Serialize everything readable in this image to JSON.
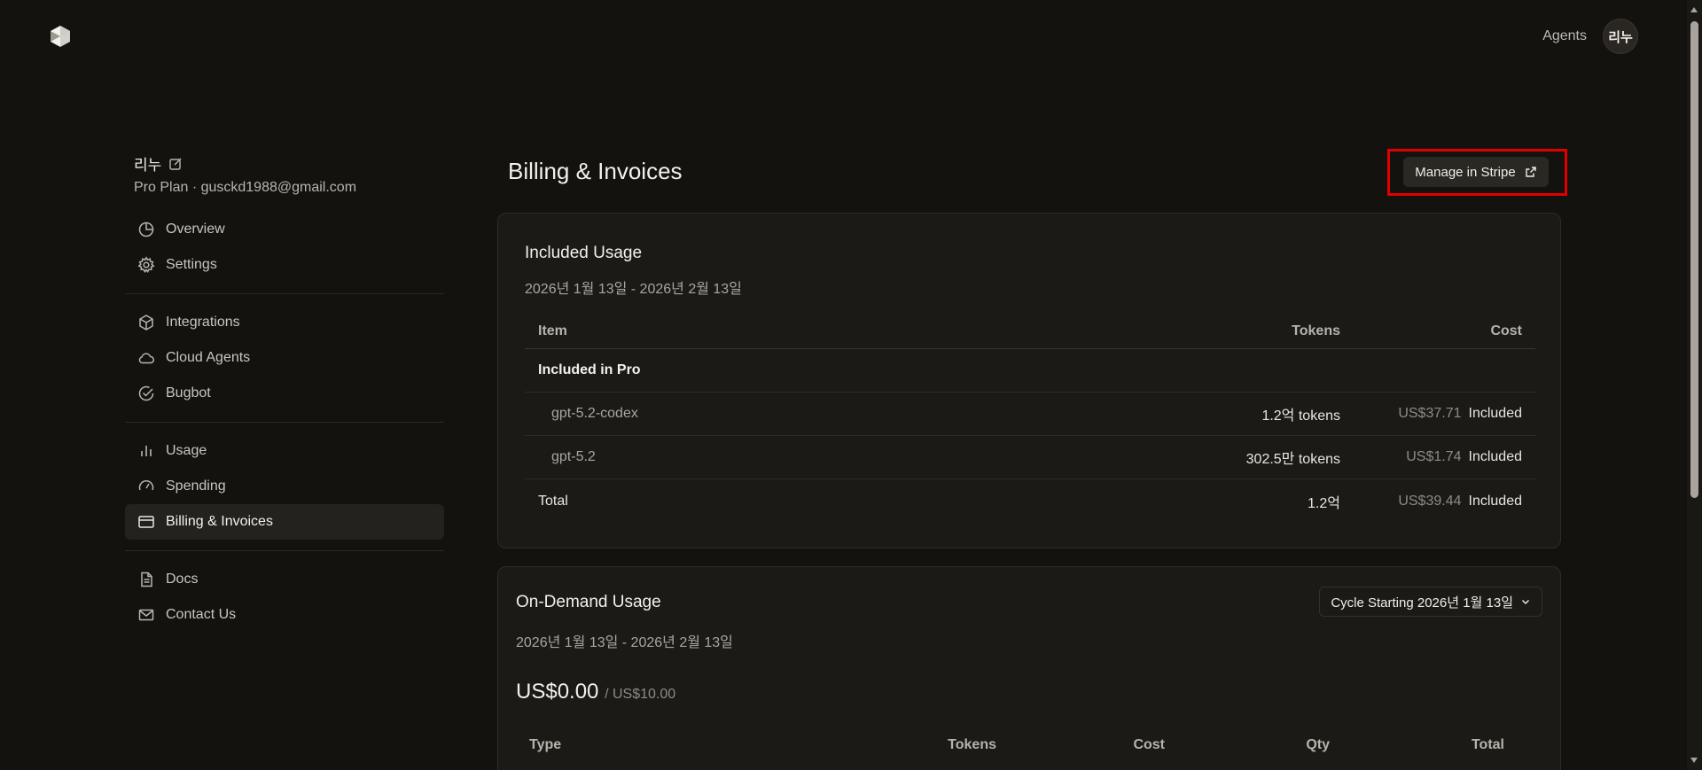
{
  "header": {
    "logo_icon": "cube-logo-icon",
    "agents_link": "Agents",
    "avatar_initials": "리누"
  },
  "sidebar": {
    "user_name": "리누",
    "user_subtitle": "Pro Plan · gusckd1988@gmail.com",
    "groups": [
      [
        {
          "label": "Overview",
          "icon": "pie-chart-icon"
        },
        {
          "label": "Settings",
          "icon": "gear-icon"
        }
      ],
      [
        {
          "label": "Integrations",
          "icon": "cube-icon"
        },
        {
          "label": "Cloud Agents",
          "icon": "cloud-icon"
        },
        {
          "label": "Bugbot",
          "icon": "check-circle-icon"
        }
      ],
      [
        {
          "label": "Usage",
          "icon": "bar-chart-icon"
        },
        {
          "label": "Spending",
          "icon": "gauge-icon"
        },
        {
          "label": "Billing & Invoices",
          "icon": "credit-card-icon",
          "active": true
        }
      ],
      [
        {
          "label": "Docs",
          "icon": "document-icon"
        },
        {
          "label": "Contact Us",
          "icon": "mail-icon"
        }
      ]
    ]
  },
  "main": {
    "title": "Billing & Invoices",
    "manage_button": "Manage in Stripe",
    "included": {
      "title": "Included Usage",
      "date_range": "2026년 1월 13일 - 2026년 2월 13일",
      "columns": [
        "Item",
        "Tokens",
        "Cost"
      ],
      "group_label": "Included in Pro",
      "rows": [
        {
          "item": "gpt-5.2-codex",
          "tokens": "1.2억 tokens",
          "cost": "US$37.71",
          "status": "Included"
        },
        {
          "item": "gpt-5.2",
          "tokens": "302.5만 tokens",
          "cost": "US$1.74",
          "status": "Included"
        }
      ],
      "total": {
        "item": "Total",
        "tokens": "1.2억",
        "cost": "US$39.44",
        "status": "Included"
      }
    },
    "ondemand": {
      "title": "On-Demand Usage",
      "cycle_label": "Cycle Starting 2026년 1월 13일",
      "date_range": "2026년 1월 13일 - 2026년 2월 13일",
      "amount": "US$0.00",
      "limit": "/ US$10.00",
      "columns": [
        "Type",
        "Tokens",
        "Cost",
        "Qty",
        "Total"
      ]
    }
  }
}
